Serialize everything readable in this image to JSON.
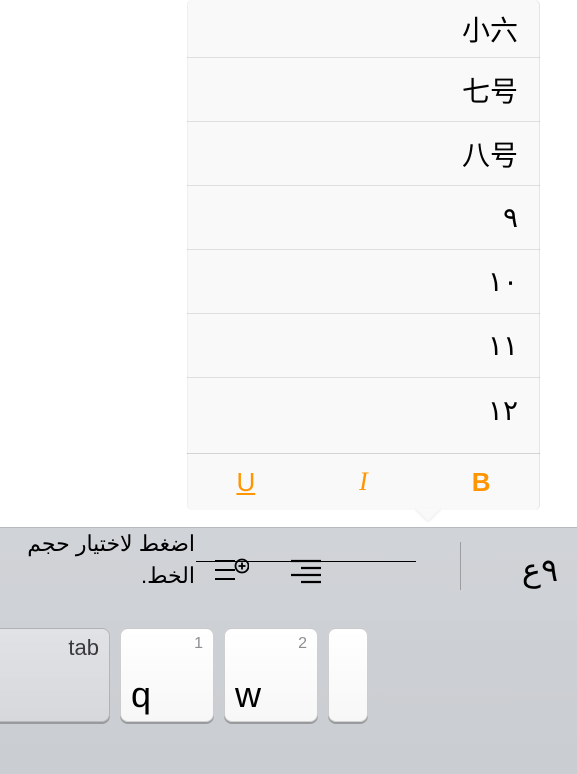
{
  "popover": {
    "sizes": [
      "小六",
      "七号",
      "八号",
      "٩",
      "١٠",
      "١١",
      "١٢"
    ],
    "styles": {
      "bold": "B",
      "italic": "I",
      "underline": "U"
    }
  },
  "toolbar": {
    "font_button": "٩ع"
  },
  "callout": {
    "text": "اضغط لاختيار حجم الخط."
  },
  "keyboard": {
    "tab": "tab",
    "keys": [
      {
        "main": "q",
        "alt": "1"
      },
      {
        "main": "w",
        "alt": "2"
      }
    ]
  }
}
